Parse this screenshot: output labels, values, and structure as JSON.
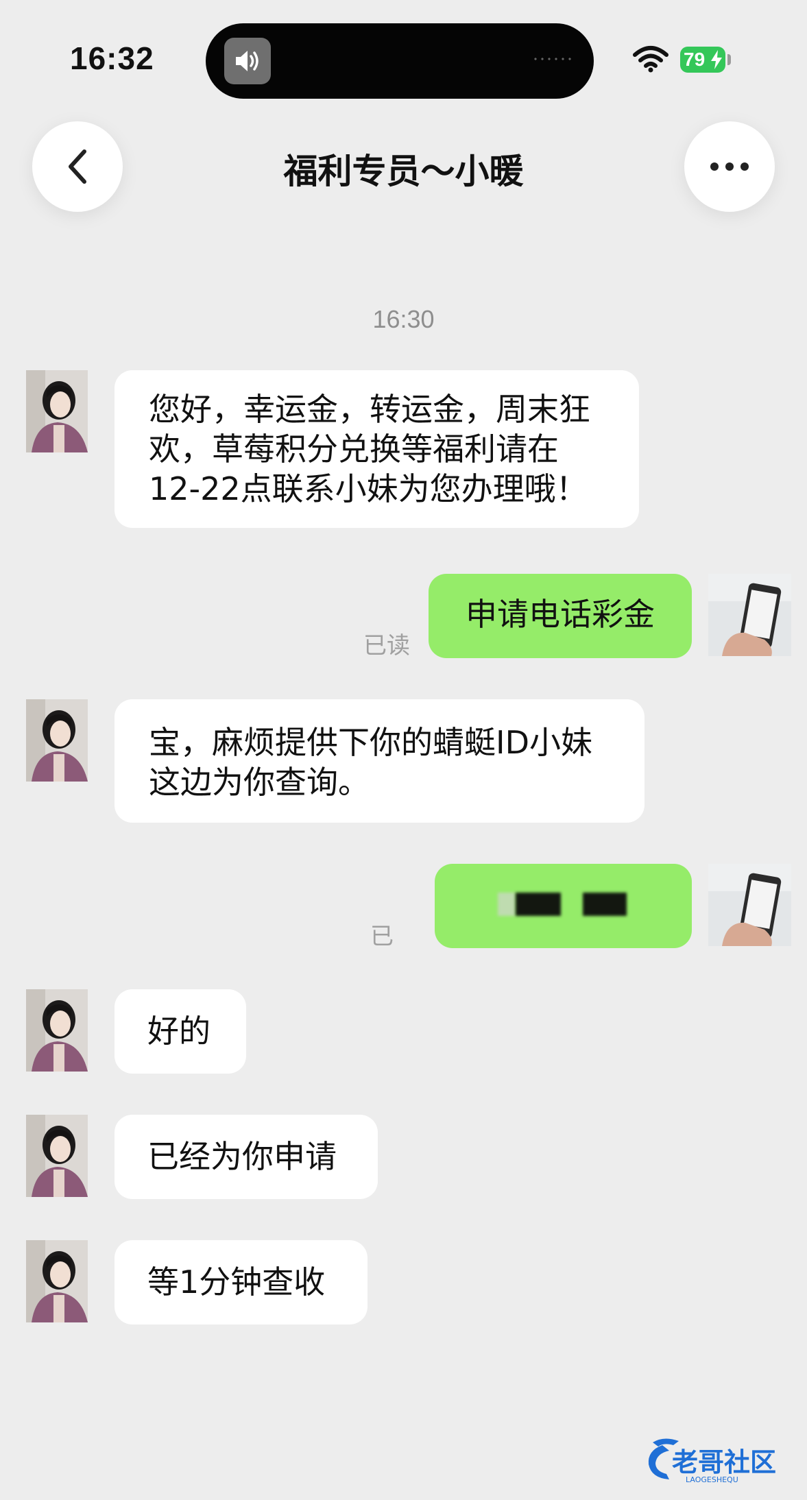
{
  "status_bar": {
    "time": "16:32",
    "battery": "79",
    "icons": [
      "speaker-icon",
      "wifi-icon",
      "battery-icon",
      "charging-bolt-icon"
    ]
  },
  "header": {
    "title": "福利专员～小暖",
    "back_icon": "chevron-left-icon",
    "more_icon": "more-dots-icon"
  },
  "chat": {
    "timestamp": "16:30",
    "messages": [
      {
        "from": "other",
        "lines": [
          "您好，幸运金，转运金，周末狂",
          "欢，草莓积分兑换等福利请在",
          "12-22点联系小妹为您办理哦！"
        ]
      },
      {
        "from": "me",
        "text": "申请电话彩金",
        "status": "已读"
      },
      {
        "from": "other",
        "lines": [
          "宝，麻烦提供下你的蜻蜓ID小妹",
          "这边为你查询。"
        ]
      },
      {
        "from": "me",
        "text": "",
        "status": "已",
        "redacted": true
      },
      {
        "from": "other",
        "text": "好的"
      },
      {
        "from": "other",
        "text": "已经为你申请"
      },
      {
        "from": "other",
        "text": "等1分钟查收"
      }
    ]
  },
  "watermark": {
    "text": "老哥社区",
    "subtext": "LAOGESHEQU"
  },
  "colors": {
    "background": "#ededed",
    "bubble_in": "#ffffff",
    "bubble_out": "#95ec69",
    "battery": "#34c759",
    "watermark": "#1f6fd6"
  }
}
